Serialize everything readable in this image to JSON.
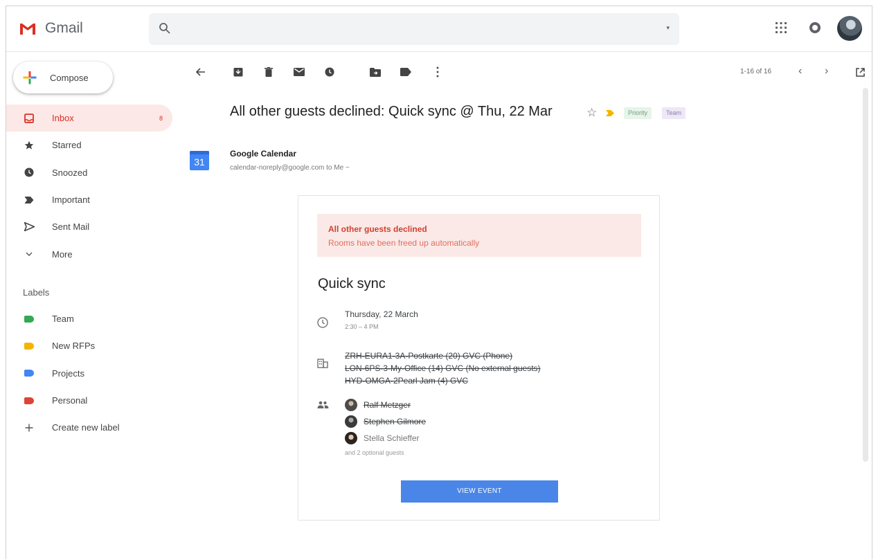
{
  "app": {
    "name": "Gmail"
  },
  "header": {
    "search_placeholder": "",
    "avatar": "user-avatar"
  },
  "sidebar": {
    "compose_label": "Compose",
    "items": [
      {
        "label": "Inbox",
        "icon": "inbox-icon",
        "count": "8",
        "active": true
      },
      {
        "label": "Starred",
        "icon": "star-icon"
      },
      {
        "label": "Snoozed",
        "icon": "clock-icon"
      },
      {
        "label": "Important",
        "icon": "important-icon"
      },
      {
        "label": "Sent Mail",
        "icon": "send-icon"
      },
      {
        "label": "More",
        "icon": "chevron-down-icon"
      }
    ],
    "labels_heading": "Labels",
    "labels": [
      {
        "label": "Team",
        "color": "#34a853"
      },
      {
        "label": "New RFPs",
        "color": "#f4b400"
      },
      {
        "label": "Projects",
        "color": "#4285f4"
      },
      {
        "label": "Personal",
        "color": "#db4437"
      }
    ],
    "create_label": "Create new label"
  },
  "toolbar": {
    "pager": "1-16 of 16"
  },
  "message": {
    "subject": "All other guests declined: Quick sync @ Thu, 22 Mar",
    "chips": [
      "Priority",
      "Team"
    ],
    "sender_name": "Google Calendar",
    "sender_meta": "calendar-noreply@google.com to Me ~",
    "calendar_day": "31"
  },
  "card": {
    "alert_title": "All other guests declined",
    "alert_sub": "Rooms have been freed up automatically",
    "event_title": "Quick sync",
    "date": "Thursday, 22 March",
    "time": "2:30 – 4 PM",
    "rooms": [
      "ZRH-EURA1-3A-Postkarte (20) GVC (Phone)",
      "LON-6PS-3-My-Office (14) GVC (No external guests)",
      "HYD-OMGA-2Pearl Jam (4) GVC"
    ],
    "guests": [
      {
        "name": "Ralf Metzger",
        "declined": true
      },
      {
        "name": "Stephen Gilmore",
        "declined": true
      },
      {
        "name": "Stella Schieffer",
        "declined": false
      }
    ],
    "optional": "and 2 optional guests",
    "button": "VIEW EVENT"
  }
}
